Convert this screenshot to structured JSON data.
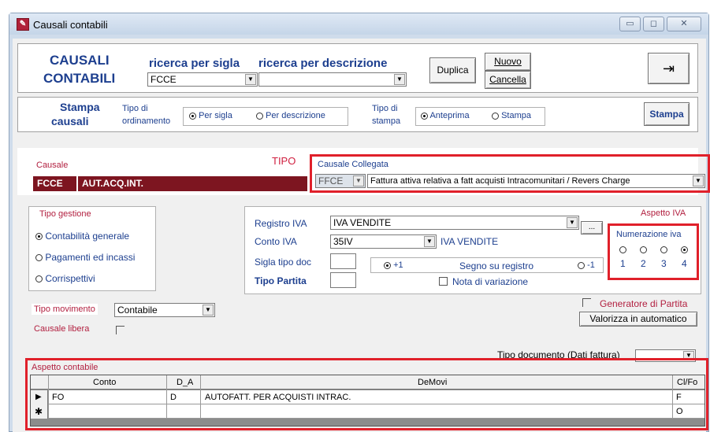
{
  "window": {
    "title": "Causali contabili",
    "app_icon_glyph": "✎",
    "buttons": {
      "minimize": "▭",
      "maximize": "◻",
      "close": "✕"
    }
  },
  "header": {
    "title_line1": "CAUSALI",
    "title_line2": "CONTABILI",
    "search_sigla_label": "ricerca per sigla",
    "search_desc_label": "ricerca per descrizione",
    "search_sigla_value": "FCCE",
    "search_desc_value": "",
    "duplica": "Duplica",
    "nuovo": "Nuovo",
    "cancella": "Cancella",
    "exit_icon": "⇥"
  },
  "stampa": {
    "title_line1": "Stampa",
    "title_line2": "causali",
    "ordinamento_label1": "Tipo di",
    "ordinamento_label2": "ordinamento",
    "per_sigla": "Per sigla",
    "per_descrizione": "Per descrizione",
    "tipo_stampa_label1": "Tipo di",
    "tipo_stampa_label2": "stampa",
    "anteprima": "Anteprima",
    "stampa_opt": "Stampa",
    "stampa_button": "Stampa"
  },
  "causale": {
    "label": "Causale",
    "code": "FCCE",
    "description": "AUT.ACQ.INT.",
    "tipo_label": "TIPO",
    "collegata_label": "Causale Collegata",
    "collegata_code": "FFCE",
    "collegata_desc": "Fattura attiva relativa a fatt acquisti Intracomunitari / Revers Charge"
  },
  "tipo_gestione": {
    "title": "Tipo gestione",
    "options": [
      "Contabilità generale",
      "Pagamenti ed incassi",
      "Corrispettivi"
    ],
    "selected": 0
  },
  "iva": {
    "registro_label": "Registro IVA",
    "registro_value": "IVA VENDITE",
    "ellipsis": "...",
    "conto_label": "Conto IVA",
    "conto_value": "35IV",
    "conto_desc": "IVA VENDITE",
    "sigla_label": "Sigla tipo doc",
    "tipo_partita_label": "Tipo Partita",
    "plus1": "+1",
    "segno_label": "Segno su registro",
    "minus1": "-1",
    "nota_label": "Nota di variazione",
    "aspetto_label": "Aspetto IVA",
    "numerazione_label": "Numerazione iva",
    "numbers": [
      "1",
      "2",
      "3",
      "4"
    ],
    "numerazione_selected": 3
  },
  "movimento": {
    "tipo_label": "Tipo movimento",
    "tipo_value": "Contabile",
    "libera_label": "Causale libera",
    "generatore_label": "Generatore di Partita",
    "valorizza_button": "Valorizza in automatico",
    "tipo_documento_label": "Tipo documento (Dati fattura)"
  },
  "grid": {
    "title": "Aspetto contabile",
    "columns": [
      "Conto",
      "D_A",
      "DeMovi",
      "Cl/Fo"
    ],
    "rows": [
      {
        "indicator": "▶",
        "conto": "FO",
        "da": "D",
        "demovi": "AUTOFATT. PER ACQUISTI INTRAC.",
        "clfo": "F"
      },
      {
        "indicator": "✱",
        "conto": "",
        "da": "",
        "demovi": "",
        "clfo": "O"
      }
    ]
  }
}
